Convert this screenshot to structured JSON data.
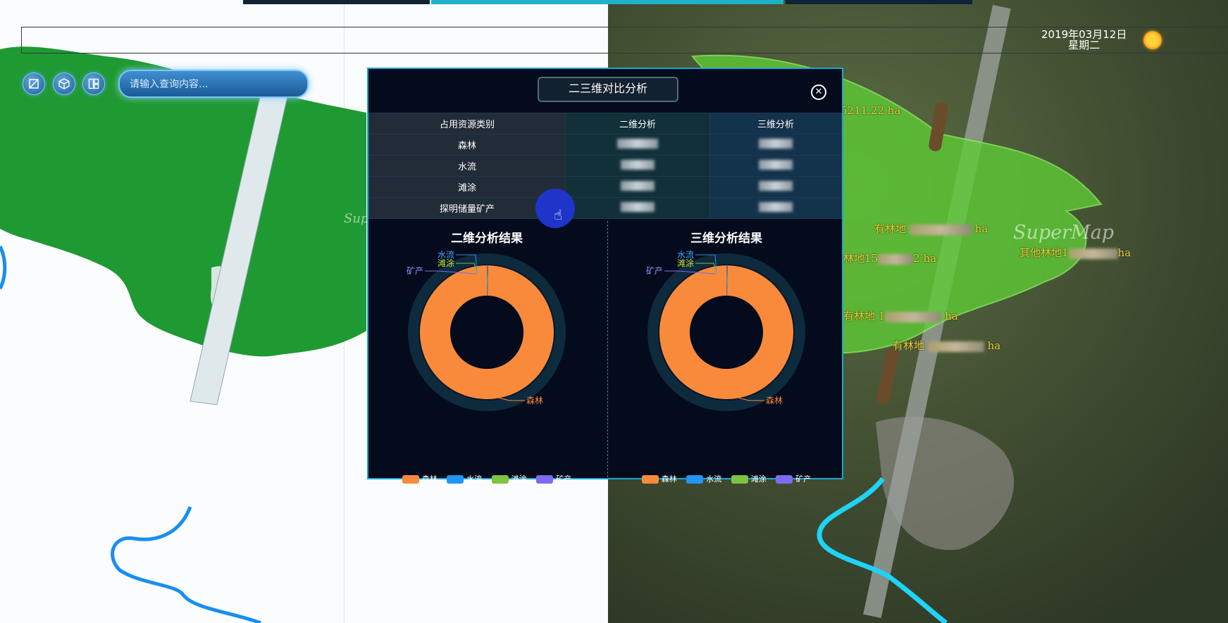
{
  "header": {
    "date": "2019年03月12日",
    "weekday": "星期二"
  },
  "toolbar": {
    "buttons": [
      {
        "icon": "map-2d-icon"
      },
      {
        "icon": "cube-3d-icon"
      },
      {
        "icon": "split-compare-icon"
      }
    ],
    "search_placeholder": "请输入查询内容..."
  },
  "map2d": {
    "watermark": "Supe"
  },
  "map3d": {
    "watermark": "SuperMap",
    "labels": [
      {
        "text": "5211.22 ha"
      },
      {
        "text": "有林地",
        "suffix": "ha"
      },
      {
        "text": "其他林地1",
        "suffix": "ha"
      },
      {
        "text": "林地15",
        "suffix": "2 ha"
      },
      {
        "text": "有林地 1",
        "suffix": "ha"
      },
      {
        "text": "有林地",
        "suffix": "ha"
      }
    ]
  },
  "dialog": {
    "title": "二三维对比分析",
    "table": {
      "headers": [
        "占用资源类别",
        "二维分析",
        "三维分析"
      ],
      "rows": [
        "森林",
        "水流",
        "滩涂",
        "探明储量矿产"
      ]
    },
    "charts": [
      {
        "title": "二维分析结果",
        "labels": [
          "水流",
          "滩涂",
          "矿产",
          "森林"
        ]
      },
      {
        "title": "三维分析结果",
        "labels": [
          "水流",
          "滩涂",
          "矿产",
          "森林"
        ]
      }
    ],
    "legend": [
      {
        "name": "森林",
        "color": "#f98a3b"
      },
      {
        "name": "水流",
        "color": "#2196f3"
      },
      {
        "name": "滩涂",
        "color": "#7fc241"
      },
      {
        "name": "矿产",
        "color": "#7b6cf2"
      }
    ]
  },
  "chart_data": [
    {
      "type": "pie",
      "title": "二维分析结果",
      "categories": [
        "森林",
        "水流",
        "滩涂",
        "矿产"
      ],
      "values": [
        99.7,
        0.1,
        0.1,
        0.1
      ],
      "colors": [
        "#f98a3b",
        "#2196f3",
        "#7fc241",
        "#7b6cf2"
      ],
      "legend": "bottom"
    },
    {
      "type": "pie",
      "title": "三维分析结果",
      "categories": [
        "森林",
        "水流",
        "滩涂",
        "矿产"
      ],
      "values": [
        99.7,
        0.1,
        0.1,
        0.1
      ],
      "colors": [
        "#f98a3b",
        "#2196f3",
        "#7fc241",
        "#7b6cf2"
      ],
      "legend": "bottom"
    }
  ]
}
